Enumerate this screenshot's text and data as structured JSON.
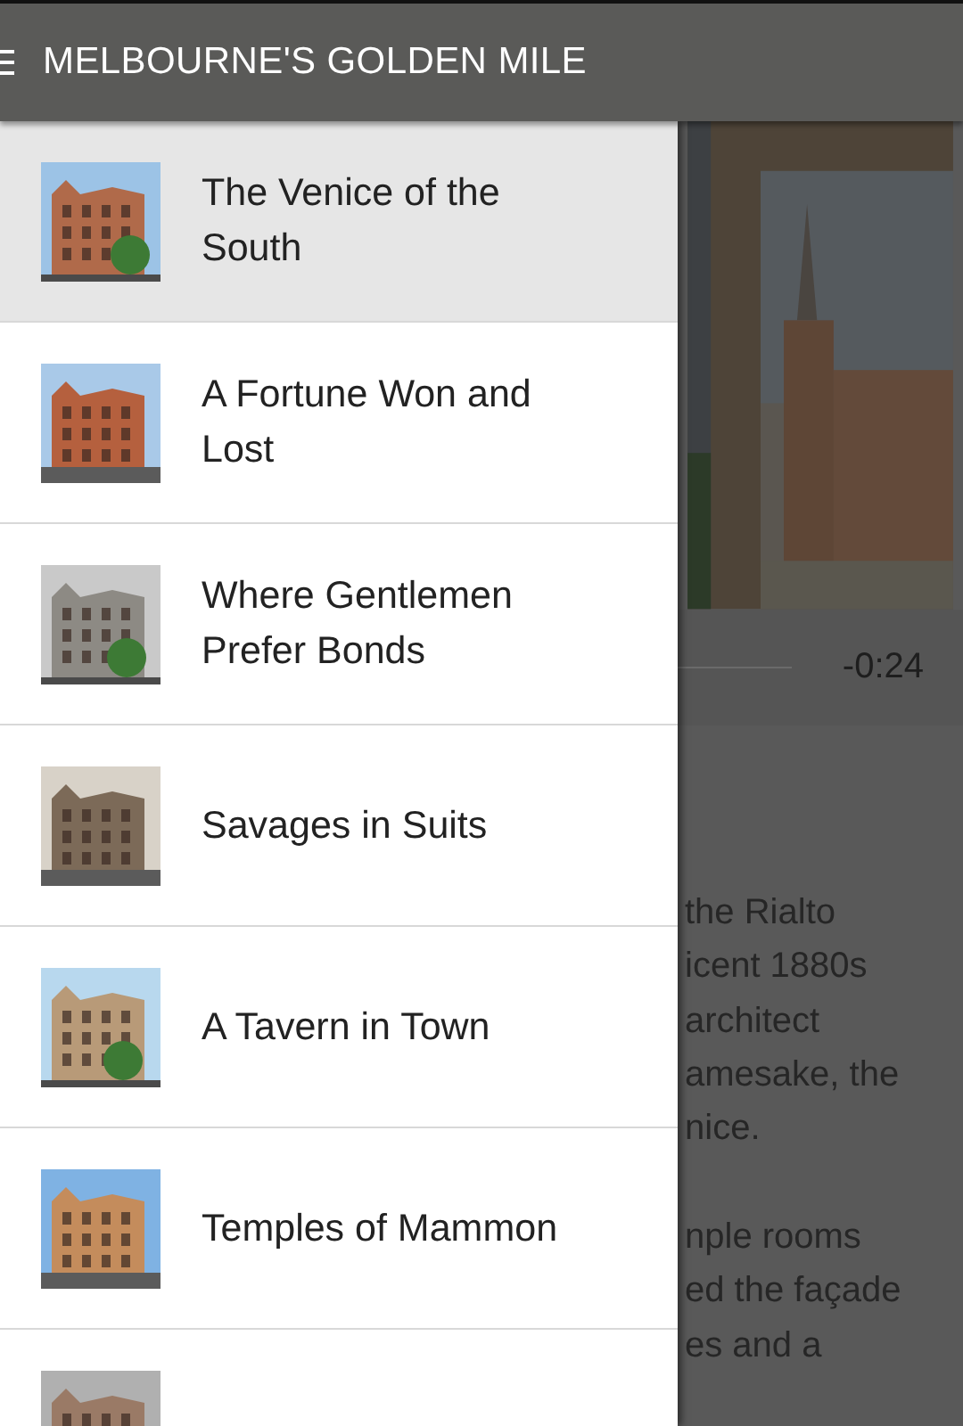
{
  "app_bar": {
    "title": "MELBOURNE'S GOLDEN MILE"
  },
  "drawer": {
    "items": [
      {
        "title": "The Venice of the South",
        "selected": true
      },
      {
        "title": "A Fortune Won and Lost",
        "selected": false
      },
      {
        "title": "Where Gentlemen Prefer Bonds",
        "selected": false
      },
      {
        "title": "Savages in Suits",
        "selected": false
      },
      {
        "title": "A Tavern in Town",
        "selected": false
      },
      {
        "title": "Temples of Mammon",
        "selected": false
      },
      {
        "selected": false
      }
    ]
  },
  "player": {
    "time": "-0:24"
  },
  "article": {
    "paragraphs": [
      [
        "the Rialto",
        "icent 1880s",
        "architect",
        "amesake, the",
        "nice."
      ],
      [
        "nple rooms",
        "ed the façade",
        "es and a"
      ]
    ]
  }
}
